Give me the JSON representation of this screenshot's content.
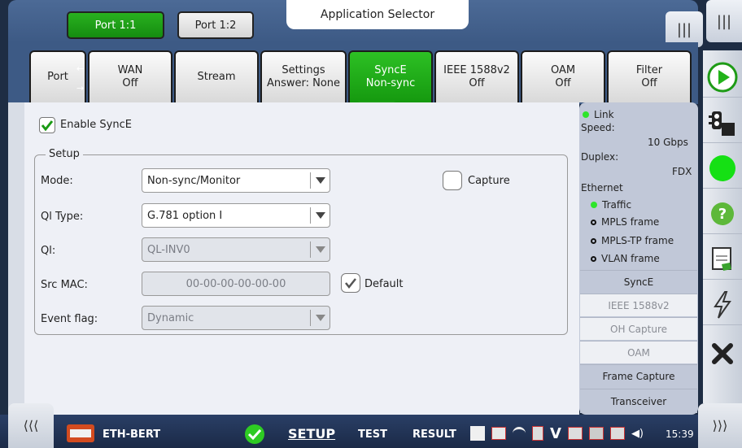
{
  "ports": {
    "port1": "Port 1:1",
    "port2": "Port 1:2"
  },
  "app_selector": "Application Selector",
  "tabs": [
    {
      "line1": "Port",
      "line2": ""
    },
    {
      "line1": "WAN",
      "line2": "Off"
    },
    {
      "line1": "Stream",
      "line2": ""
    },
    {
      "line1": "Settings",
      "line2": "Answer: None"
    },
    {
      "line1": "SyncE",
      "line2": "Non-sync"
    },
    {
      "line1": "IEEE 1588v2",
      "line2": "Off"
    },
    {
      "line1": "OAM",
      "line2": "Off"
    },
    {
      "line1": "Filter",
      "line2": "Off"
    }
  ],
  "enable_synce": {
    "label": "Enable SyncE",
    "checked": true
  },
  "setup": {
    "legend": "Setup",
    "mode": {
      "label": "Mode:",
      "value": "Non-sync/Monitor"
    },
    "capture": {
      "label": "Capture",
      "checked": false
    },
    "ql_type": {
      "label": "Ql Type:",
      "value": "G.781 option I"
    },
    "ql": {
      "label": "Ql:",
      "value": "QL-INV0"
    },
    "src_mac": {
      "label": "Src MAC:",
      "value": "00-00-00-00-00-00"
    },
    "default": {
      "label": "Default",
      "checked": true
    },
    "event_flag": {
      "label": "Event flag:",
      "value": "Dynamic"
    }
  },
  "status": {
    "link": "Link",
    "speed_label": "Speed:",
    "speed_value": "10 Gbps",
    "duplex_label": "Duplex:",
    "duplex_value": "FDX",
    "ethernet": "Ethernet",
    "items": [
      "Traffic",
      "MPLS frame",
      "MPLS-TP frame",
      "VLAN frame"
    ],
    "buttons": [
      "SyncE",
      "IEEE 1588v2",
      "OH Capture",
      "OAM",
      "Frame Capture",
      "Transceiver"
    ]
  },
  "bottom": {
    "app": "ETH-BERT",
    "setup": "SETUP",
    "test": "TEST",
    "result": "RESULT",
    "time": "15:39"
  },
  "colors": {
    "active_green": "#1d9f16",
    "panel_bg": "#eef0f6",
    "header_blue": "#3d5a85"
  }
}
